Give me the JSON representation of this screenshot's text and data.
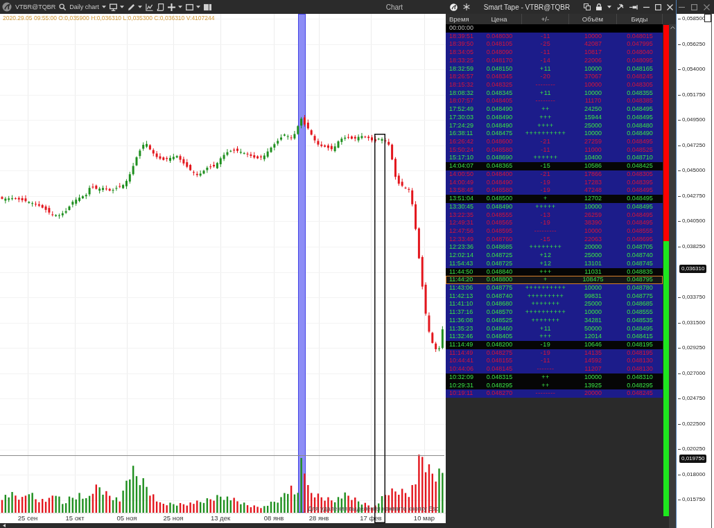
{
  "chart_window": {
    "title": "Chart",
    "toolbar": {
      "symbol": "VTBR@TQBR",
      "chart_type": "Daily chart"
    },
    "info_line": "2020.29.05 09:55:00 O:0,035900 H:0,036310 L:0,035300 C:0,036310 V:4107244",
    "price_axis": [
      {
        "kind": "label",
        "text": "0,058500"
      },
      {
        "kind": "label",
        "text": "0,056250"
      },
      {
        "kind": "label",
        "text": "0,054000"
      },
      {
        "kind": "label",
        "text": "0,051750"
      },
      {
        "kind": "label",
        "text": "0,049500"
      },
      {
        "kind": "label",
        "text": "0,047250"
      },
      {
        "kind": "label",
        "text": "0,045000"
      },
      {
        "kind": "label",
        "text": "0,042750"
      },
      {
        "kind": "label",
        "text": "0,040500"
      },
      {
        "kind": "label",
        "text": "0,038250"
      },
      {
        "kind": "last_price",
        "text": "0,036310"
      },
      {
        "kind": "label",
        "text": "0,033750"
      },
      {
        "kind": "label",
        "text": "0,031500"
      },
      {
        "kind": "label",
        "text": "0,029250"
      },
      {
        "kind": "label",
        "text": "0,027000"
      },
      {
        "kind": "label",
        "text": "0,024750"
      },
      {
        "kind": "label",
        "text": "0,022500"
      },
      {
        "kind": "label",
        "text": "0,020250"
      },
      {
        "kind": "level",
        "text": "0,019750"
      },
      {
        "kind": "label",
        "text": "0,018000"
      },
      {
        "kind": "label",
        "text": "0,015750"
      }
    ],
    "date_axis": [
      "25 сен",
      "15 окт",
      "05 ноя",
      "25 ноя",
      "13 дек",
      "08 янв",
      "28 янв",
      "17 фев",
      "10 мар"
    ],
    "hint": "Для удаления выделения нажмите кнопку Esc"
  },
  "smart_tape": {
    "title": "Smart Tape - VTBR@TQBR",
    "columns": [
      "Время",
      "Цена",
      "+/-",
      "Объём",
      "Биды"
    ],
    "session_row": "00:00:00",
    "rows": [
      {
        "time": "18:39:51",
        "price": "0.048030",
        "change": "-11",
        "volume": "10000",
        "bid": "0.048015",
        "sell": true,
        "highlighted": false,
        "selected": false
      },
      {
        "time": "18:39:50",
        "price": "0.048105",
        "change": "-25",
        "volume": "42087",
        "bid": "0.047995",
        "sell": true,
        "highlighted": false,
        "selected": false
      },
      {
        "time": "18:34:05",
        "price": "0.048090",
        "change": "-11",
        "volume": "10817",
        "bid": "0.048040",
        "sell": true,
        "highlighted": false,
        "selected": false
      },
      {
        "time": "18:33:25",
        "price": "0.048170",
        "change": "-14",
        "volume": "22006",
        "bid": "0.048095",
        "sell": true,
        "highlighted": false,
        "selected": false
      },
      {
        "time": "18:32:59",
        "price": "0.048150",
        "change": "+11",
        "volume": "10000",
        "bid": "0.048165",
        "sell": false,
        "highlighted": false,
        "selected": false
      },
      {
        "time": "18:26:57",
        "price": "0.048345",
        "change": "-20",
        "volume": "37067",
        "bid": "0.048245",
        "sell": true,
        "highlighted": false,
        "selected": false
      },
      {
        "time": "18:15:32",
        "price": "0.048325",
        "change": "--------",
        "volume": "10000",
        "bid": "0.048305",
        "sell": true,
        "highlighted": false,
        "selected": false
      },
      {
        "time": "18:08:32",
        "price": "0.048345",
        "change": "+11",
        "volume": "10000",
        "bid": "0.048355",
        "sell": false,
        "highlighted": false,
        "selected": false
      },
      {
        "time": "18:07:57",
        "price": "0.048405",
        "change": "--------",
        "volume": "11170",
        "bid": "0.048385",
        "sell": true,
        "highlighted": false,
        "selected": false
      },
      {
        "time": "17:52:49",
        "price": "0.048490",
        "change": "++",
        "volume": "24250",
        "bid": "0.048495",
        "sell": false,
        "highlighted": false,
        "selected": false
      },
      {
        "time": "17:30:03",
        "price": "0.048490",
        "change": "+++",
        "volume": "15944",
        "bid": "0.048495",
        "sell": false,
        "highlighted": false,
        "selected": false
      },
      {
        "time": "17:24:29",
        "price": "0.048490",
        "change": "++++",
        "volume": "25000",
        "bid": "0.048480",
        "sell": false,
        "highlighted": false,
        "selected": false
      },
      {
        "time": "16:38:11",
        "price": "0.048475",
        "change": "++++++++++",
        "volume": "10000",
        "bid": "0.048490",
        "sell": false,
        "highlighted": false,
        "selected": false
      },
      {
        "time": "16:26:42",
        "price": "0.048600",
        "change": "-21",
        "volume": "27259",
        "bid": "0.048495",
        "sell": true,
        "highlighted": false,
        "selected": false
      },
      {
        "time": "15:50:24",
        "price": "0.048580",
        "change": "-11",
        "volume": "11000",
        "bid": "0.048525",
        "sell": true,
        "highlighted": false,
        "selected": false
      },
      {
        "time": "15:17:10",
        "price": "0.048690",
        "change": "++++++",
        "volume": "10400",
        "bid": "0.048710",
        "sell": false,
        "highlighted": false,
        "selected": false
      },
      {
        "time": "14:04:07",
        "price": "0.048365",
        "change": "-15",
        "volume": "10586",
        "bid": "0.048425",
        "sell": false,
        "highlighted": true,
        "selected": false
      },
      {
        "time": "14:00:50",
        "price": "0.048400",
        "change": "-21",
        "volume": "17866",
        "bid": "0.048305",
        "sell": true,
        "highlighted": false,
        "selected": false
      },
      {
        "time": "14:00:49",
        "price": "0.048490",
        "change": "-19",
        "volume": "17283",
        "bid": "0.048395",
        "sell": true,
        "highlighted": false,
        "selected": false
      },
      {
        "time": "13:58:45",
        "price": "0.048580",
        "change": "-19",
        "volume": "47248",
        "bid": "0.048495",
        "sell": true,
        "highlighted": false,
        "selected": false
      },
      {
        "time": "13:51:04",
        "price": "0.048500",
        "change": "+",
        "volume": "12702",
        "bid": "0.048495",
        "sell": false,
        "highlighted": true,
        "selected": false
      },
      {
        "time": "13:30:45",
        "price": "0.048490",
        "change": "+++++",
        "volume": "10000",
        "bid": "0.048495",
        "sell": false,
        "highlighted": false,
        "selected": false
      },
      {
        "time": "13:22:35",
        "price": "0.048555",
        "change": "-13",
        "volume": "26259",
        "bid": "0.048495",
        "sell": true,
        "highlighted": false,
        "selected": false
      },
      {
        "time": "12:49:31",
        "price": "0.048565",
        "change": "-19",
        "volume": "38390",
        "bid": "0.048495",
        "sell": true,
        "highlighted": false,
        "selected": false
      },
      {
        "time": "12:47:56",
        "price": "0.048595",
        "change": "---------",
        "volume": "10000",
        "bid": "0.048555",
        "sell": true,
        "highlighted": false,
        "selected": false
      },
      {
        "time": "12:33:49",
        "price": "0.048760",
        "change": "-15",
        "volume": "22063",
        "bid": "0.048695",
        "sell": true,
        "highlighted": false,
        "selected": false
      },
      {
        "time": "12:23:36",
        "price": "0.048685",
        "change": "++++++++",
        "volume": "20000",
        "bid": "0.048705",
        "sell": false,
        "highlighted": false,
        "selected": false
      },
      {
        "time": "12:02:14",
        "price": "0.048725",
        "change": "+12",
        "volume": "25000",
        "bid": "0.048740",
        "sell": false,
        "highlighted": false,
        "selected": false
      },
      {
        "time": "11:54:43",
        "price": "0.048725",
        "change": "+12",
        "volume": "13101",
        "bid": "0.048745",
        "sell": false,
        "highlighted": false,
        "selected": false
      },
      {
        "time": "11:44:50",
        "price": "0.048840",
        "change": "+++",
        "volume": "11031",
        "bid": "0.048835",
        "sell": false,
        "highlighted": true,
        "selected": false
      },
      {
        "time": "11:44:20",
        "price": "0.048800",
        "change": "+",
        "volume": "108475",
        "bid": "0.048795",
        "sell": false,
        "highlighted": true,
        "selected": true
      },
      {
        "time": "11:43:06",
        "price": "0.048775",
        "change": "++++++++++",
        "volume": "10000",
        "bid": "0.048780",
        "sell": false,
        "highlighted": false,
        "selected": false
      },
      {
        "time": "11:42:13",
        "price": "0.048740",
        "change": "+++++++++",
        "volume": "99831",
        "bid": "0.048775",
        "sell": false,
        "highlighted": false,
        "selected": false
      },
      {
        "time": "11:41:10",
        "price": "0.048680",
        "change": "+++++++",
        "volume": "25000",
        "bid": "0.048685",
        "sell": false,
        "highlighted": false,
        "selected": false
      },
      {
        "time": "11:37:16",
        "price": "0.048570",
        "change": "++++++++++",
        "volume": "10000",
        "bid": "0.048555",
        "sell": false,
        "highlighted": false,
        "selected": false
      },
      {
        "time": "11:36:08",
        "price": "0.048525",
        "change": "+++++++",
        "volume": "34281",
        "bid": "0.048535",
        "sell": false,
        "highlighted": false,
        "selected": false
      },
      {
        "time": "11:35:23",
        "price": "0.048460",
        "change": "+11",
        "volume": "50000",
        "bid": "0.048495",
        "sell": false,
        "highlighted": false,
        "selected": false
      },
      {
        "time": "11:32:46",
        "price": "0.048405",
        "change": "+++",
        "volume": "12014",
        "bid": "0.048415",
        "sell": false,
        "highlighted": false,
        "selected": false
      },
      {
        "time": "11:14:49",
        "price": "0.048200",
        "change": "-19",
        "volume": "10646",
        "bid": "0.048195",
        "sell": false,
        "highlighted": true,
        "selected": false
      },
      {
        "time": "11:14:49",
        "price": "0.048275",
        "change": "-19",
        "volume": "14135",
        "bid": "0.048195",
        "sell": true,
        "highlighted": false,
        "selected": false
      },
      {
        "time": "10:44:41",
        "price": "0.048155",
        "change": "-11",
        "volume": "14592",
        "bid": "0.048130",
        "sell": true,
        "highlighted": false,
        "selected": false
      },
      {
        "time": "10:44:06",
        "price": "0.048145",
        "change": "-------",
        "volume": "11207",
        "bid": "0.048130",
        "sell": true,
        "highlighted": false,
        "selected": false
      },
      {
        "time": "10:32:09",
        "price": "0.048315",
        "change": "++",
        "volume": "10000",
        "bid": "0.048310",
        "sell": false,
        "highlighted": true,
        "selected": false
      },
      {
        "time": "10:29:31",
        "price": "0.048295",
        "change": "++",
        "volume": "13925",
        "bid": "0.048295",
        "sell": false,
        "highlighted": true,
        "selected": false
      },
      {
        "time": "10:19:11",
        "price": "0.048270",
        "change": "--------",
        "volume": "20000",
        "bid": "0.048245",
        "sell": true,
        "highlighted": false,
        "selected": false
      }
    ],
    "balance_bar": {
      "level": 0.44
    }
  }
}
